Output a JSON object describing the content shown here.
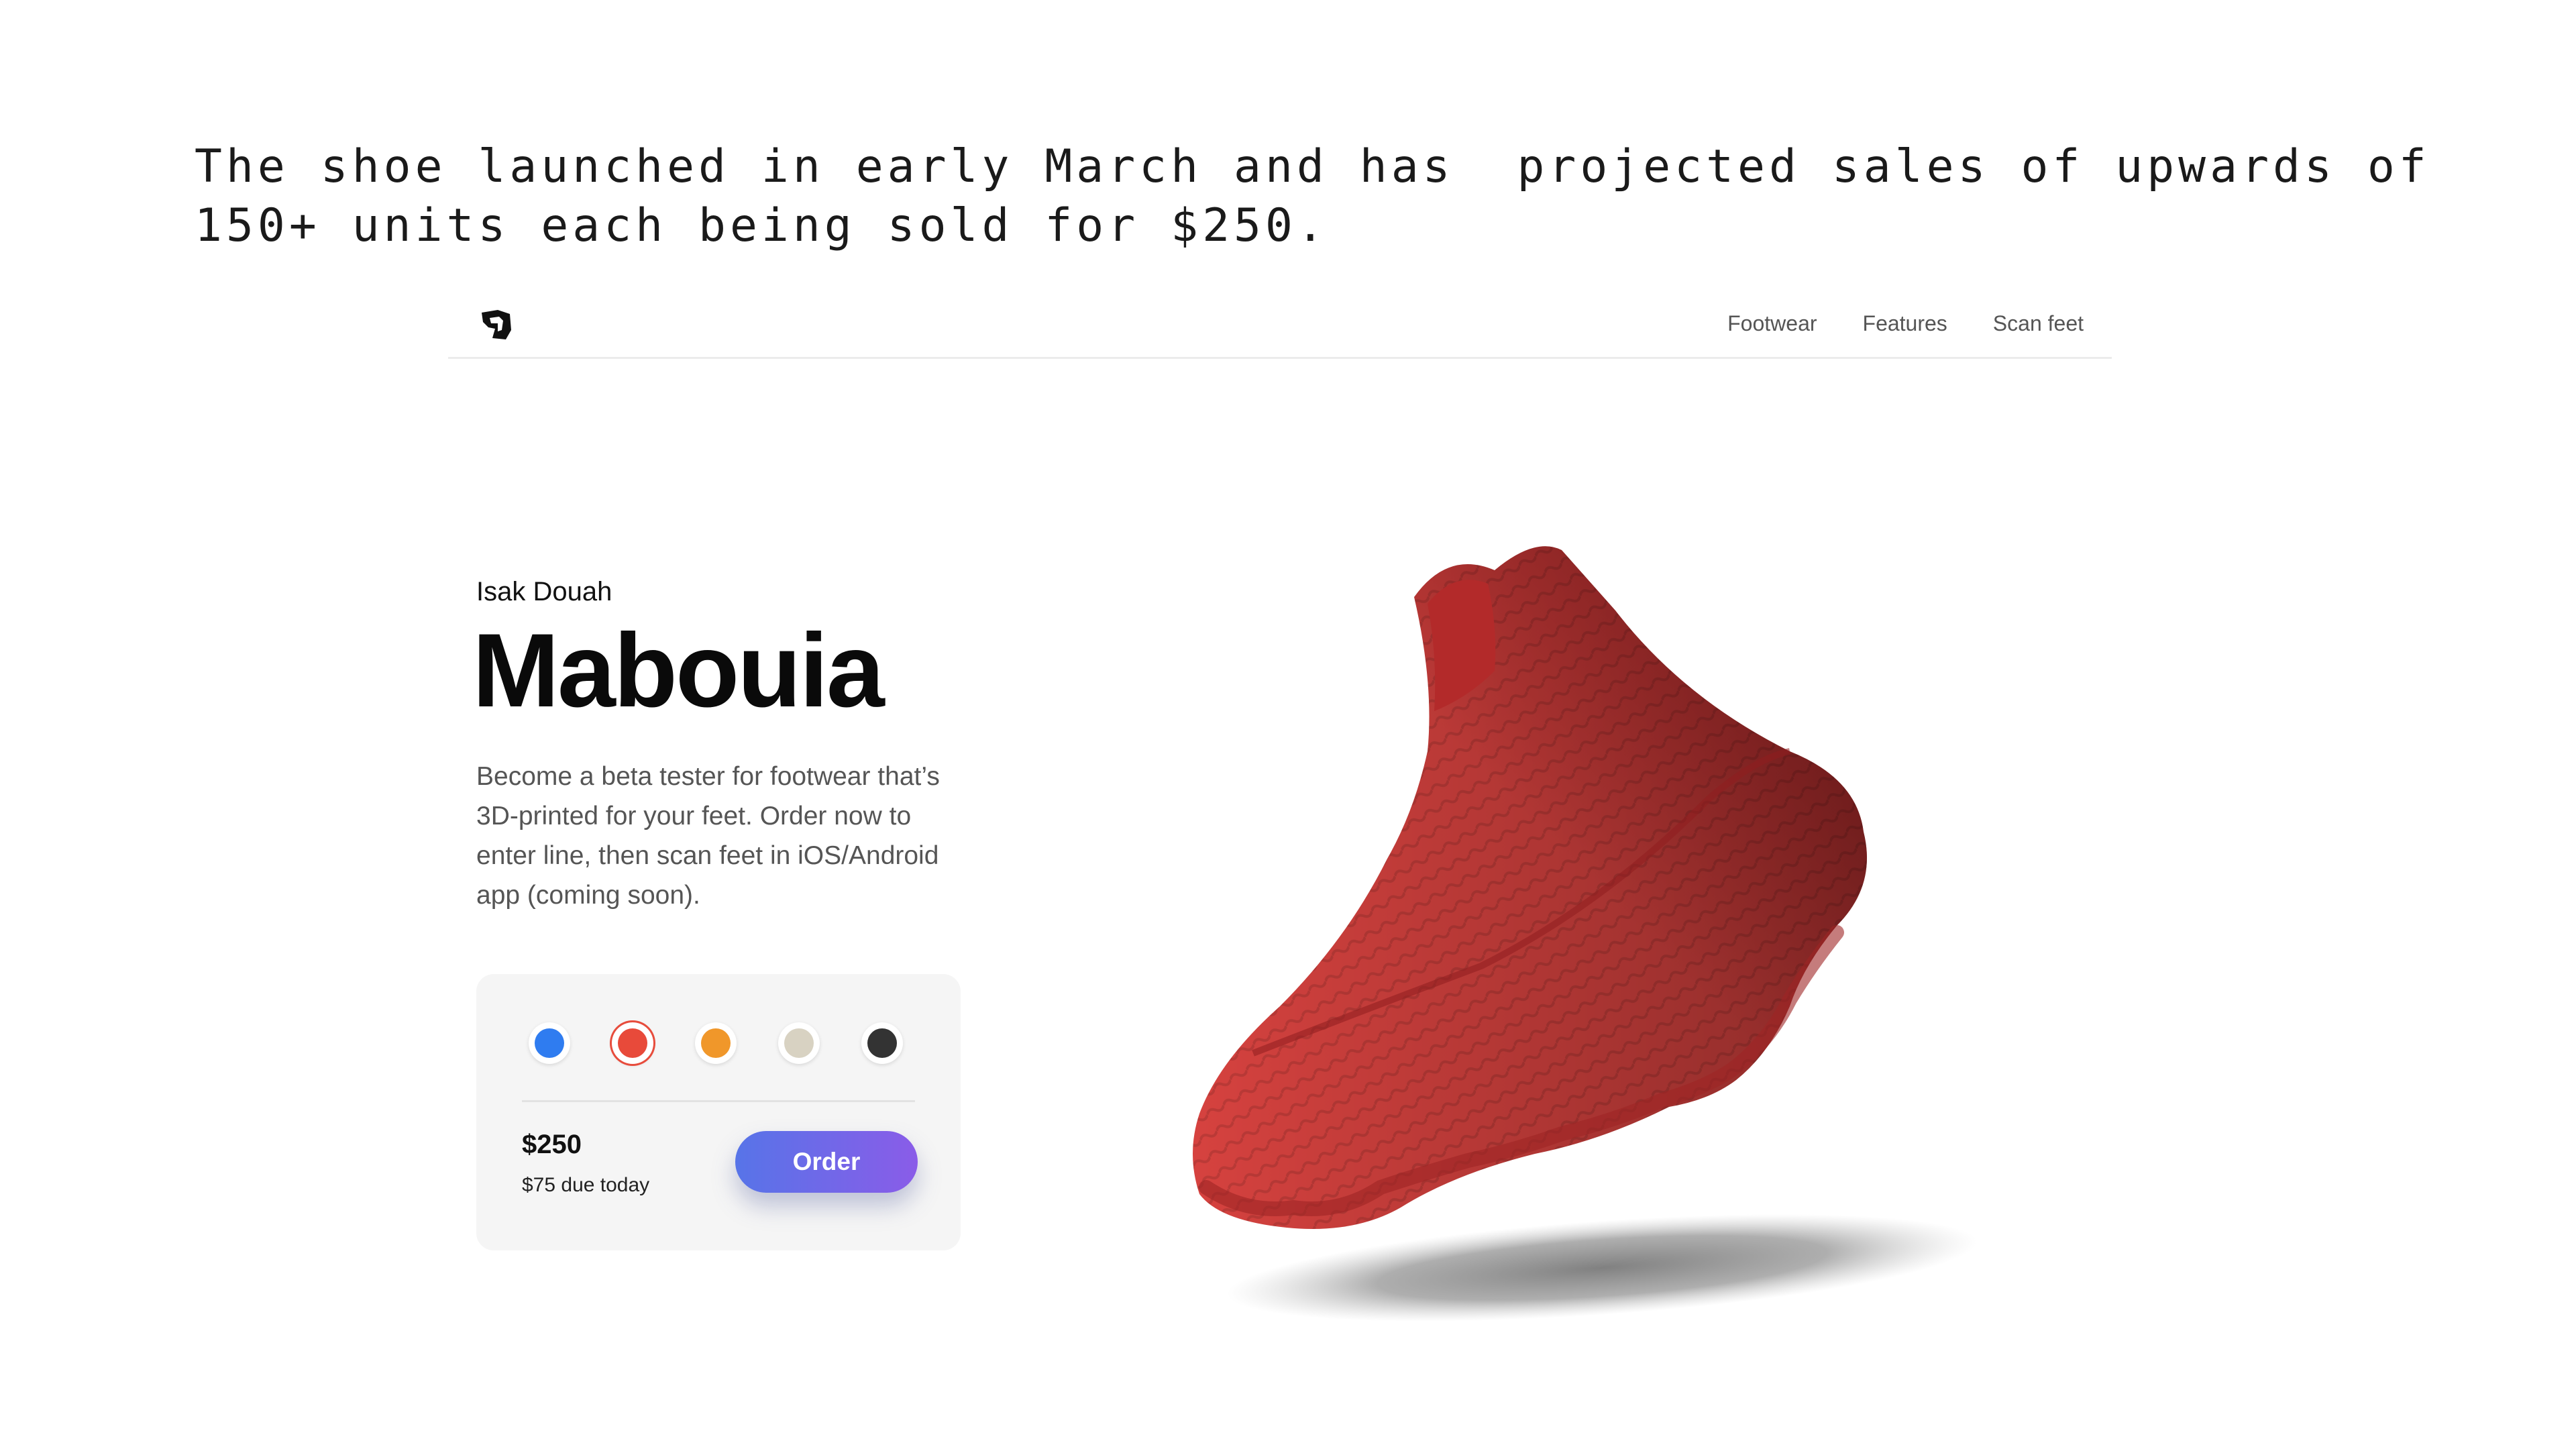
{
  "caption": {
    "text": "The shoe launched in early March and has  projected sales of upwards of 150+ units each being sold for $250."
  },
  "navbar": {
    "logo_icon": "brand-logo-icon",
    "links": [
      {
        "label": "Footwear"
      },
      {
        "label": "Features"
      },
      {
        "label": "Scan feet"
      }
    ]
  },
  "product": {
    "designer": "Isak Douah",
    "name": "Mabouia",
    "description": "Become a beta tester for footwear that’s 3D-printed for your feet. Order now to enter line, then scan feet in iOS/Android app (coming soon)."
  },
  "order_card": {
    "colors": [
      {
        "name": "blue",
        "hex": "#2f7cf0",
        "selected": false
      },
      {
        "name": "red",
        "hex": "#e84a3a",
        "selected": true
      },
      {
        "name": "orange",
        "hex": "#f0972a",
        "selected": false
      },
      {
        "name": "beige",
        "hex": "#d8d2c2",
        "selected": false
      },
      {
        "name": "black",
        "hex": "#333333",
        "selected": false
      }
    ],
    "price": "$250",
    "due_today": "$75 due today",
    "order_label": "Order"
  },
  "colors": {
    "shoe_red": "#d6423f",
    "shoe_dark": "#8f1d1f",
    "button_gradient_start": "#5774e8",
    "button_gradient_end": "#8a5ce8",
    "card_bg": "#f5f5f5"
  }
}
